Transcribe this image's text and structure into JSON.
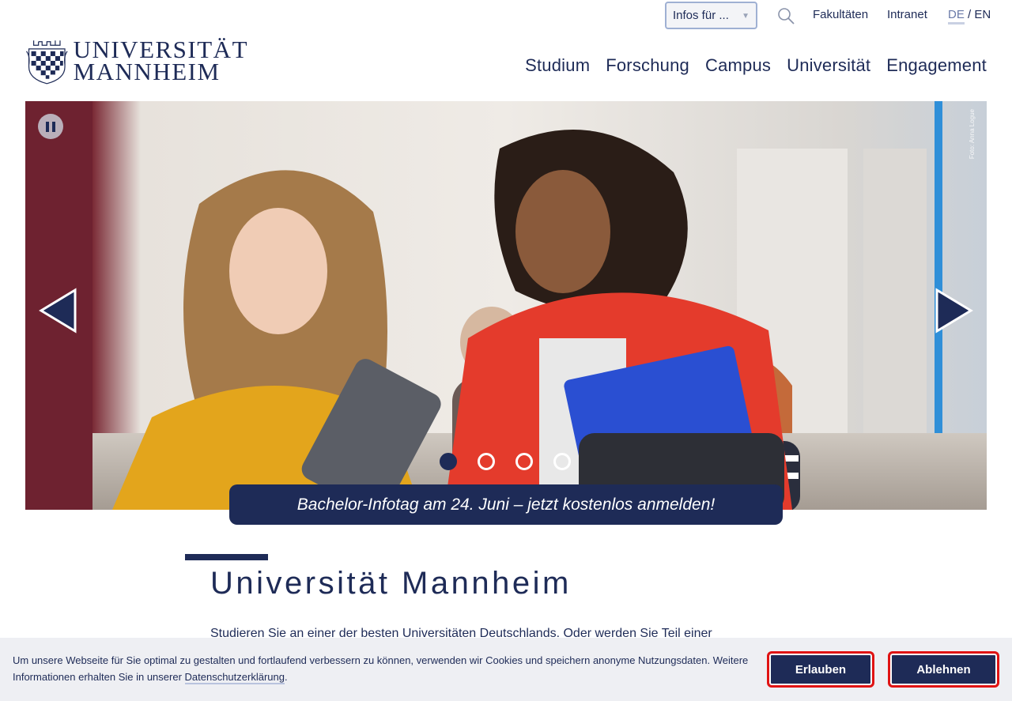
{
  "header": {
    "logo_line1": "UNIVERSITÄT",
    "logo_line2": "MANNHEIM",
    "infos_select": {
      "value": "Infos für ..."
    },
    "meta_links": [
      "Fakultäten",
      "Intranet"
    ],
    "lang": {
      "de": "DE",
      "separator": "/",
      "en": "EN",
      "active": "DE"
    },
    "main_nav": [
      "Studium",
      "Forschung",
      "Campus",
      "Universität",
      "Engagement"
    ]
  },
  "hero": {
    "photo_credit": "Foto: Anna Logue",
    "slide_count": 4,
    "active_slide": 1,
    "banner": "Bachelor-Infotag am 24. Juni – jetzt kostenlos anmelden!"
  },
  "main": {
    "title": "Universität Mannheim",
    "intro": "Studieren Sie an einer der besten Universitäten Deutschlands. Oder werden Sie Teil einer"
  },
  "cookie": {
    "text_before_link": "Um unsere Webseite für Sie optimal zu gestalten und fortlaufend verbessern zu können, verwenden wir Cookies und speichern anonyme Nutzungsdaten. Weitere Informationen erhalten Sie in unserer ",
    "link": "Datenschutzerklärung",
    "text_after_link": ".",
    "allow_label": "Erlauben",
    "deny_label": "Ablehnen"
  },
  "colors": {
    "brand": "#1e2b57",
    "cookie_bg": "#eeeff3",
    "button_border": "#e01313"
  },
  "icons": [
    "search-icon",
    "pause-icon",
    "arrow-left-icon",
    "arrow-right-icon",
    "chevron-down-icon",
    "university-crest-icon"
  ]
}
